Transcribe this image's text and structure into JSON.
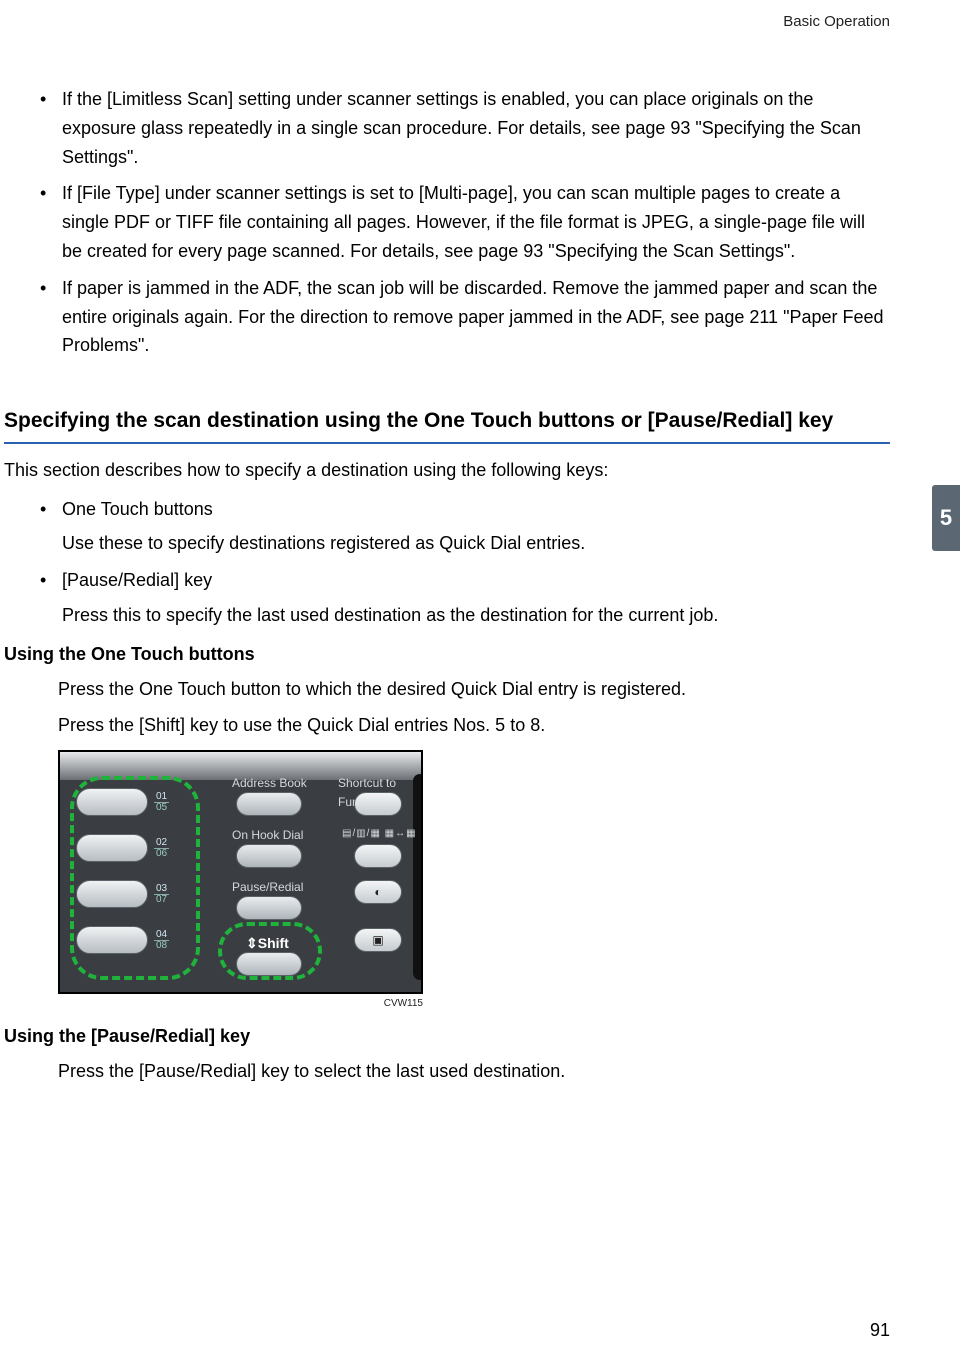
{
  "header": {
    "title": "Basic Operation"
  },
  "tab": {
    "number": "5"
  },
  "bullets_top": [
    "If the [Limitless Scan] setting under scanner settings is enabled, you can place originals on the exposure glass repeatedly in a single scan procedure. For details, see page 93 \"Specifying the Scan Settings\".",
    "If [File Type] under scanner settings is set to [Multi-page], you can scan multiple pages to create a single PDF or TIFF file containing all pages. However, if the file format is JPEG, a single-page file will be created for every page scanned. For details, see page 93 \"Specifying the Scan Settings\".",
    "If paper is jammed in the ADF, the scan job will be discarded. Remove the jammed paper and scan the entire originals again. For the direction to remove paper jammed in the ADF, see page 211 \"Paper Feed Problems\"."
  ],
  "h2": "Specifying the scan destination using the One Touch buttons or [Pause/Redial] key",
  "intro": "This section describes how to specify a destination using the following keys:",
  "bullets_keys": [
    {
      "title": "One Touch buttons",
      "desc": "Use these to specify destinations registered as Quick Dial entries."
    },
    {
      "title": "[Pause/Redial] key",
      "desc": "Press this to specify the last used destination as the destination for the current job."
    }
  ],
  "using_ot": {
    "heading": "Using the One Touch buttons",
    "p1": "Press the One Touch button to which the desired Quick Dial entry is registered.",
    "p2": "Press the [Shift] key to use the Quick Dial entries Nos. 5 to 8."
  },
  "panel": {
    "labels": {
      "address_book": "Address Book",
      "on_hook": "On Hook Dial",
      "pause_redial": "Pause/Redial",
      "shift": "Shift",
      "shortcut": "Shortcut to Func."
    },
    "ot_numbers": [
      {
        "top": "01",
        "bottom": "05"
      },
      {
        "top": "02",
        "bottom": "06"
      },
      {
        "top": "03",
        "bottom": "07"
      },
      {
        "top": "04",
        "bottom": "08"
      }
    ],
    "caption": "CVW115"
  },
  "using_pr": {
    "heading": "Using the [Pause/Redial] key",
    "p1": "Press the [Pause/Redial] key to select the last used destination."
  },
  "page_number": "91"
}
